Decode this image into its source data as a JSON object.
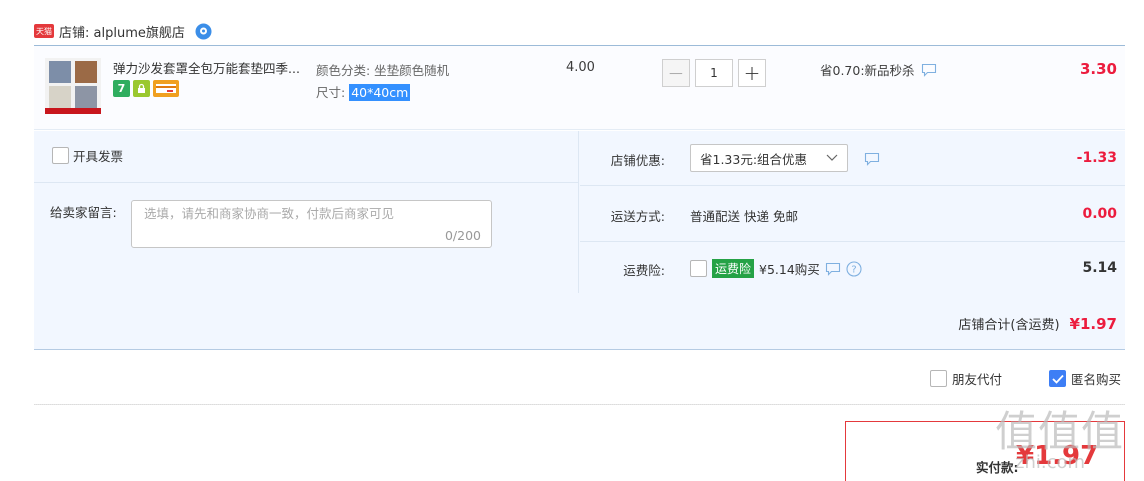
{
  "shop": {
    "tmall_label": "天猫",
    "name": "店铺: alplume旗舰店"
  },
  "item": {
    "title": "弹力沙发套罩全包万能套垫四季...",
    "sku_color": "颜色分类: 坐垫颜色随机",
    "sku_size_label": "尺寸: ",
    "sku_size_value": "40*40cm",
    "badge_7": "7",
    "price": "4.00",
    "quantity": "1",
    "qty_minus": "−",
    "qty_plus": "+",
    "promo": "省0.70:新品秒杀",
    "subtotal": "3.30"
  },
  "invoice_label": "开具发票",
  "message": {
    "label": "给卖家留言:",
    "placeholder": "选填，请先和商家协商一致，付款后商家可见",
    "count": "0/200"
  },
  "coupon": {
    "label": "店铺优惠:",
    "selected": "省1.33元:组合优惠",
    "value": "-1.33"
  },
  "shipping": {
    "label": "运送方式:",
    "text": "普通配送 快递 免邮",
    "value": "0.00"
  },
  "insurance": {
    "label": "运费险:",
    "badge": "运费险",
    "text": "¥5.14购买",
    "value": "5.14"
  },
  "shop_total": {
    "label": "店铺合计(含运费)",
    "value": "¥1.97"
  },
  "options": {
    "friend_pay": "朋友代付",
    "anonymous": "匿名购买"
  },
  "pay": {
    "label": "实付款:",
    "value": "¥1.97"
  },
  "watermark": {
    "main": "值值值",
    "sub": "zhi.com"
  },
  "colors": {
    "accent_red": "#ec1c3e",
    "blue_check": "#3d7ef5",
    "insurance_green": "#25a246"
  }
}
